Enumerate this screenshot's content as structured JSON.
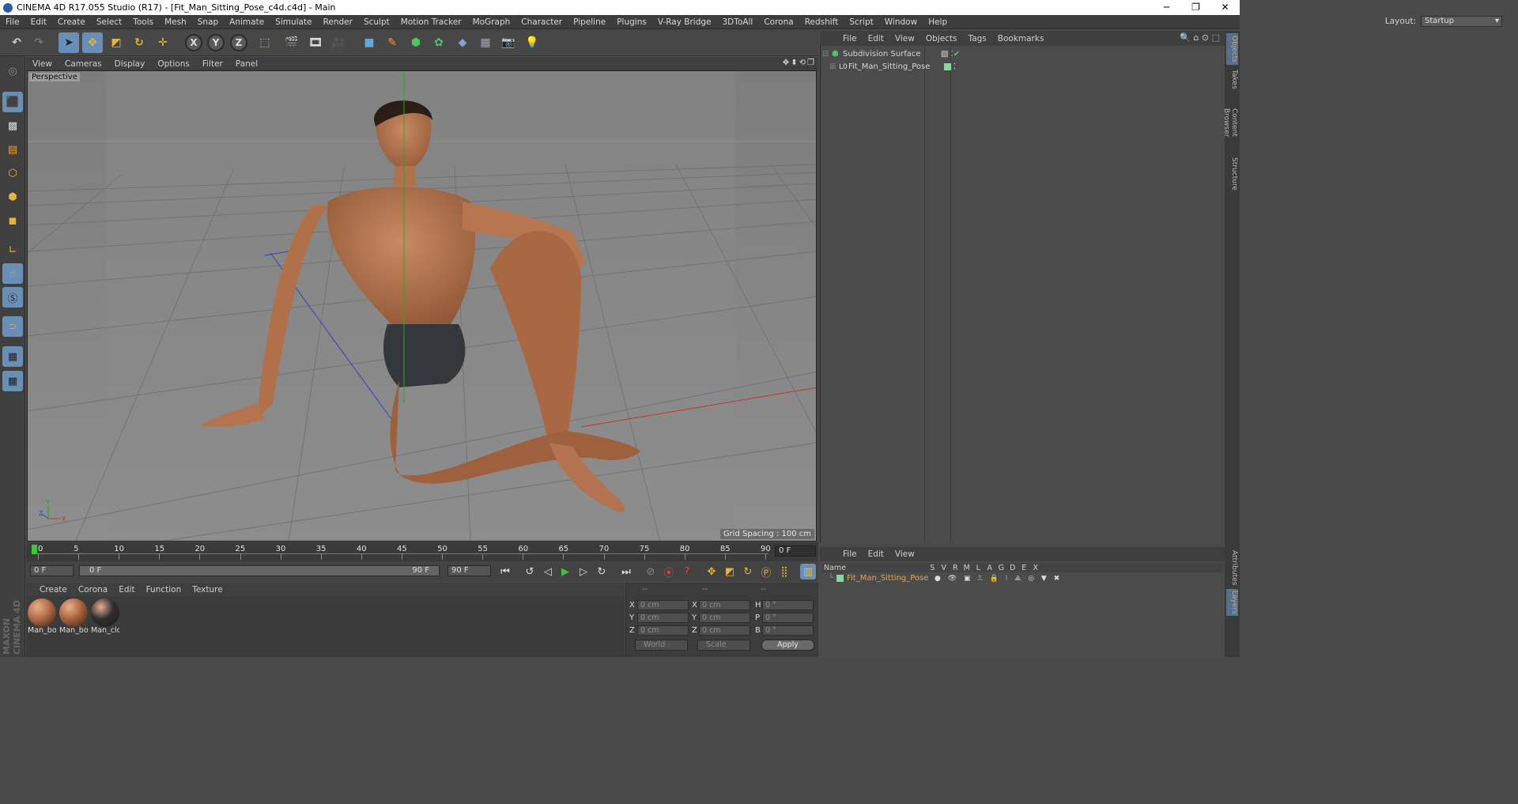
{
  "window": {
    "title": "CINEMA 4D R17.055 Studio (R17) - [Fit_Man_Sitting_Pose_c4d.c4d] - Main",
    "min": "─",
    "restore": "❐",
    "close": "✕"
  },
  "menubar": [
    "File",
    "Edit",
    "Create",
    "Select",
    "Tools",
    "Mesh",
    "Snap",
    "Animate",
    "Simulate",
    "Render",
    "Sculpt",
    "Motion Tracker",
    "MoGraph",
    "Character",
    "Pipeline",
    "Plugins",
    "V-Ray Bridge",
    "3DToAll",
    "Corona",
    "Redshift",
    "Script",
    "Window",
    "Help"
  ],
  "layout": {
    "label": "Layout:",
    "value": "Startup"
  },
  "toolbar": {
    "axis_x": "X",
    "axis_y": "Y",
    "axis_z": "Z"
  },
  "viewport": {
    "menu": [
      "View",
      "Cameras",
      "Display",
      "Options",
      "Filter",
      "Panel"
    ],
    "camera_label": "Perspective",
    "grid_spacing": "Grid Spacing : 100 cm"
  },
  "timeline": {
    "ticks": [
      "0",
      "5",
      "10",
      "15",
      "20",
      "25",
      "30",
      "35",
      "40",
      "45",
      "50",
      "55",
      "60",
      "65",
      "70",
      "75",
      "80",
      "85",
      "90"
    ],
    "current_frame": "0 F",
    "start": "0 F",
    "range_start": "0 F",
    "range_end": "90 F",
    "end": "90 F"
  },
  "materials": {
    "menu": [
      "Create",
      "Corona",
      "Edit",
      "Function",
      "Texture"
    ],
    "items": [
      {
        "label": "Man_bo",
        "color": "#b06a45"
      },
      {
        "label": "Man_bo",
        "color": "#a9643f"
      },
      {
        "label": "Man_clc",
        "color": "#2e2e33"
      }
    ]
  },
  "coordinates": {
    "headers": [
      "--",
      "--",
      "--"
    ],
    "rows": [
      {
        "a": "X",
        "av": "0 cm",
        "b": "X",
        "bv": "0 cm",
        "c": "H",
        "cv": "0 °"
      },
      {
        "a": "Y",
        "av": "0 cm",
        "b": "Y",
        "bv": "0 cm",
        "c": "P",
        "cv": "0 °"
      },
      {
        "a": "Z",
        "av": "0 cm",
        "b": "Z",
        "bv": "0 cm",
        "c": "B",
        "cv": "0 °"
      }
    ],
    "space": "World",
    "mode": "Scale",
    "apply": "Apply"
  },
  "object_manager": {
    "menu": [
      "File",
      "Edit",
      "View",
      "Objects",
      "Tags",
      "Bookmarks"
    ],
    "objects": [
      {
        "name": "Subdivision Surface"
      },
      {
        "name": "Fit_Man_Sitting_Pose"
      }
    ]
  },
  "layer_manager": {
    "menu": [
      "File",
      "Edit",
      "View"
    ],
    "columns": [
      "Name",
      "S",
      "V",
      "R",
      "M",
      "L",
      "A",
      "G",
      "D",
      "E",
      "X"
    ],
    "layers": [
      {
        "name": "Fit_Man_Sitting_Pose",
        "color": "#8fd3a0"
      }
    ]
  },
  "right_tabs": [
    "Objects",
    "Takes",
    "Content Browser",
    "Structure"
  ],
  "right_tabs_bottom": [
    "Attributes",
    "Layers"
  ],
  "brand": "MAXON CINEMA 4D",
  "colors": {
    "accent": "#6a8fb7",
    "highlight_text": "#e7a24a",
    "green_axis": "#2aa52a",
    "red_axis": "#c0392b",
    "blue_axis": "#3344bb"
  }
}
